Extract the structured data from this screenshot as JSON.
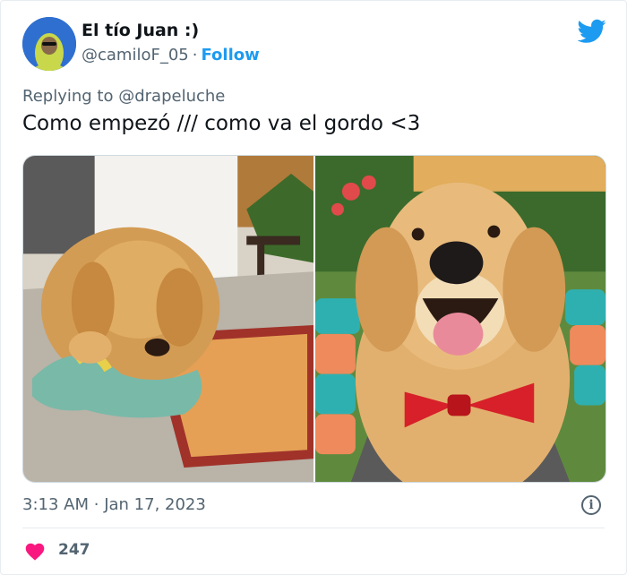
{
  "author": {
    "display_name": "El tío Juan :)",
    "handle": "@camiloF_05",
    "separator": "·",
    "follow_label": "Follow"
  },
  "reply": {
    "prefix": "Replying to",
    "mention": "@drapeluche"
  },
  "tweet": {
    "text": "Como empezó /// como va el gordo <3"
  },
  "media": {
    "images": [
      {
        "description": "puppy-chewing-rope-toy"
      },
      {
        "description": "adult-golden-retriever-red-bowtie"
      }
    ]
  },
  "meta": {
    "time": "3:13 AM",
    "separator": "·",
    "date": "Jan 17, 2023",
    "info_glyph": "i"
  },
  "engagement": {
    "likes": "247"
  },
  "colors": {
    "accent": "#1d9bf0",
    "heart": "#f91880",
    "secondary_text": "#536471"
  },
  "icons": {
    "brand": "twitter-bird-icon",
    "like": "heart-icon",
    "info": "info-icon"
  }
}
